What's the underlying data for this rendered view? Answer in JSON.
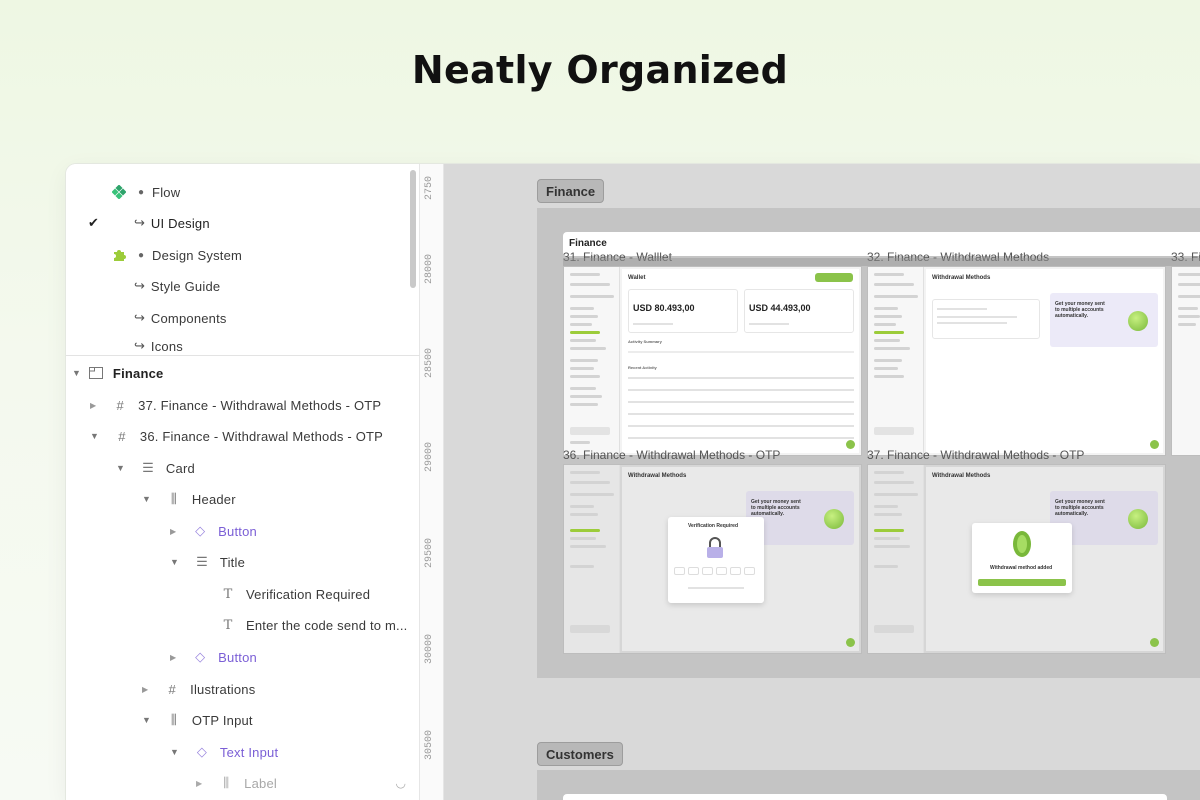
{
  "hero": {
    "title": "Neatly Organized"
  },
  "pages": [
    {
      "label": "Flow",
      "icon": "component-icon"
    },
    {
      "label": "UI Design",
      "icon": "return-arrow-icon",
      "checked": true
    },
    {
      "label": "Design System",
      "icon": "puzzle-icon"
    },
    {
      "label": "Style Guide",
      "icon": "return-arrow-icon"
    },
    {
      "label": "Components",
      "icon": "return-arrow-icon"
    },
    {
      "label": "Icons",
      "icon": "return-arrow-icon"
    }
  ],
  "layers": [
    {
      "label": "Finance",
      "icon": "section-icon"
    },
    {
      "label": "37. Finance - Withdrawal Methods - OTP",
      "icon": "frame-hash-icon"
    },
    {
      "label": "36. Finance - Withdrawal Methods - OTP",
      "icon": "frame-hash-icon"
    },
    {
      "label": "Card",
      "icon": "auto-layout-rows-icon"
    },
    {
      "label": "Header",
      "icon": "auto-layout-cols-icon"
    },
    {
      "label": "Button",
      "icon": "instance-diamond-icon"
    },
    {
      "label": "Title",
      "icon": "auto-layout-rows-icon"
    },
    {
      "label": "Verification Required",
      "icon": "text-t-icon"
    },
    {
      "label": "Enter the code send to m...",
      "icon": "text-t-icon"
    },
    {
      "label": "Button",
      "icon": "instance-diamond-icon"
    },
    {
      "label": "Ilustrations",
      "icon": "frame-hash-icon"
    },
    {
      "label": "OTP Input",
      "icon": "auto-layout-cols-icon"
    },
    {
      "label": "Text Input",
      "icon": "instance-diamond-icon"
    },
    {
      "label": "Label",
      "icon": "auto-layout-cols-icon"
    }
  ],
  "ruler": [
    "2750",
    "28000",
    "28500",
    "29000",
    "29500",
    "30000",
    "30500"
  ],
  "canvas": {
    "sections": [
      {
        "label": "Finance"
      },
      {
        "label": "Customers"
      }
    ],
    "frame_title": "Finance",
    "frames": [
      {
        "label": "31. Finance - Walllet",
        "screen_title": "Wallet"
      },
      {
        "label": "32. Finance - Withdrawal Methods",
        "screen_title": "Withdrawal Methods"
      },
      {
        "label": "33. Fi",
        "screen_title": ""
      },
      {
        "label": "36. Finance - Withdrawal Methods - OTP",
        "screen_title": "Withdrawal Methods"
      },
      {
        "label": "37. Finance - Withdrawal Methods - OTP",
        "screen_title": "Withdrawal Methods"
      }
    ],
    "wallet": {
      "amount_1": "USD 80.493,00",
      "amount_2": "USD 44.493,00",
      "activity": "Activity Summary",
      "recent": "Recent Activity"
    },
    "promo": "Get your money sent to multiple accounts automatically.",
    "otp_modal": {
      "title": "Verification Required"
    },
    "success_modal": {
      "title": "Withdrawal method added"
    }
  },
  "colors": {
    "accent_green": "#8bc34a",
    "layer_purple": "#7b5fd6",
    "canvas_gray": "#d9d9d9"
  }
}
